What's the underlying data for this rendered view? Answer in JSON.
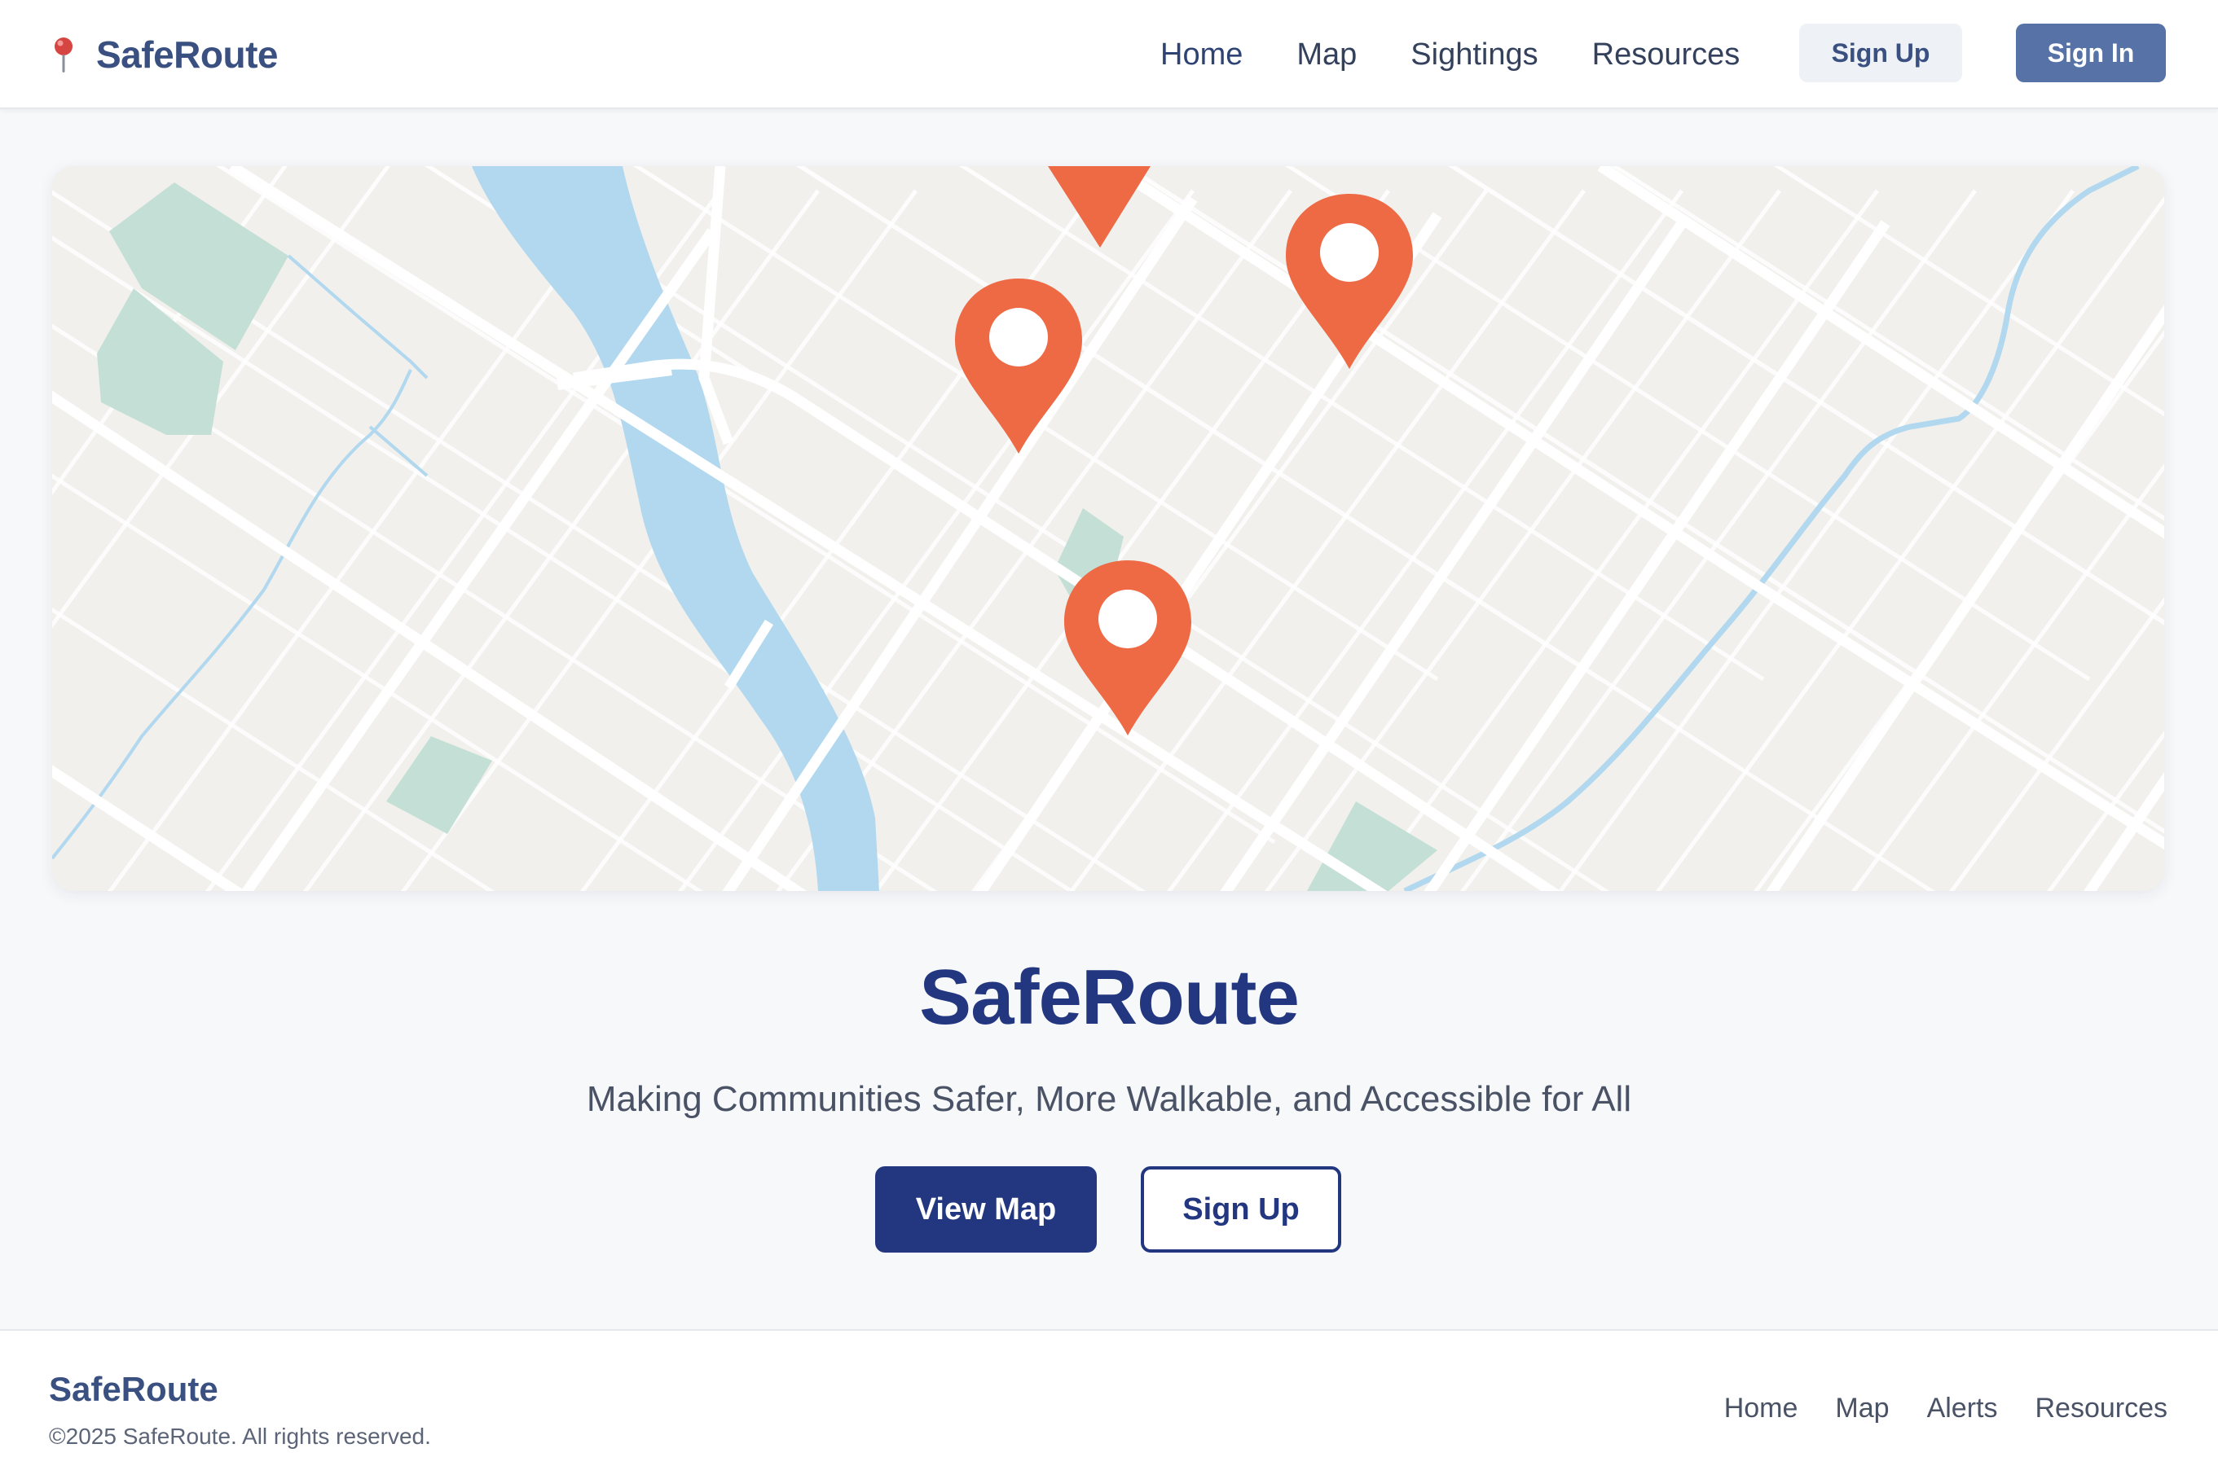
{
  "header": {
    "brand_icon": "map-pin-icon",
    "brand_name": "SafeRoute",
    "nav": [
      {
        "label": "Home"
      },
      {
        "label": "Map"
      },
      {
        "label": "Sightings"
      },
      {
        "label": "Resources"
      }
    ],
    "sign_up_label": "Sign Up",
    "sign_in_label": "Sign In"
  },
  "map": {
    "marker_icon": "location-marker-icon",
    "marker_color": "#ee6a45",
    "water_color": "#b1d8ee",
    "park_color": "#c4e0d6",
    "land_color": "#f1f0ed"
  },
  "hero": {
    "title": "SafeRoute",
    "subtitle": "Making Communities Safer, More Walkable, and Accessible for All",
    "primary_cta": "View Map",
    "secondary_cta": "Sign Up"
  },
  "footer": {
    "brand": "SafeRoute",
    "copyright": "©2025 SafeRoute. All rights reserved.",
    "links": [
      {
        "label": "Home"
      },
      {
        "label": "Map"
      },
      {
        "label": "Alerts"
      },
      {
        "label": "Resources"
      }
    ]
  },
  "colors": {
    "primary": "#233780",
    "accent": "#5672a6",
    "background": "#f7f8fa"
  }
}
